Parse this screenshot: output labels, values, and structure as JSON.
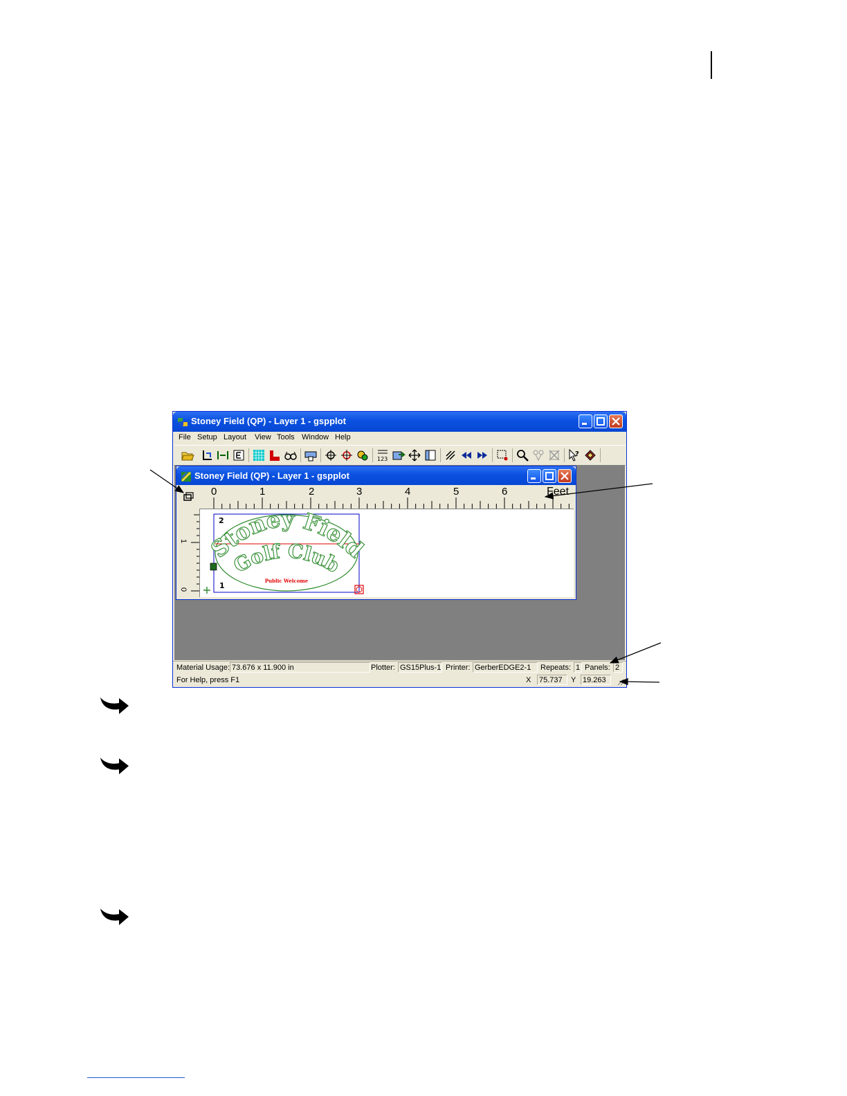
{
  "app": {
    "title": "Stoney Field (QP) - Layer 1 - gspplot",
    "menu": [
      "File",
      "Setup",
      "Layout",
      "View",
      "Tools",
      "Window",
      "Help"
    ]
  },
  "child_window": {
    "title": "Stoney Field (QP) - Layer 1 - gspplot",
    "ruler_top": [
      "0",
      "1",
      "2",
      "3",
      "4",
      "5",
      "6"
    ],
    "ruler_unit": "Feet",
    "ruler_left": [
      "1",
      "0"
    ]
  },
  "design": {
    "line1": "Stoney Field",
    "line2": "Golf Club",
    "line3": "Public Welcome",
    "marker_top": "2",
    "marker_bottom": "1"
  },
  "status": {
    "material_label": "Material Usage:",
    "material_value": "73.676 x 11.900 in",
    "plotter_label": "Plotter:",
    "plotter_value": "GS15Plus-1",
    "printer_label": "Printer:",
    "printer_value": "GerberEDGE2-1",
    "repeats_label": "Repeats:",
    "repeats_value": "1",
    "panels_label": "Panels:",
    "panels_value": "2",
    "help_text": "For Help, press F1",
    "x_label": "X",
    "x_value": "75.737",
    "y_label": "Y",
    "y_value": "19.263"
  },
  "colors": {
    "titlebar": "#0a51e0",
    "design_outline": "#2e8b2e",
    "accent_red": "#e00000",
    "selection_blue": "#0000c8"
  }
}
